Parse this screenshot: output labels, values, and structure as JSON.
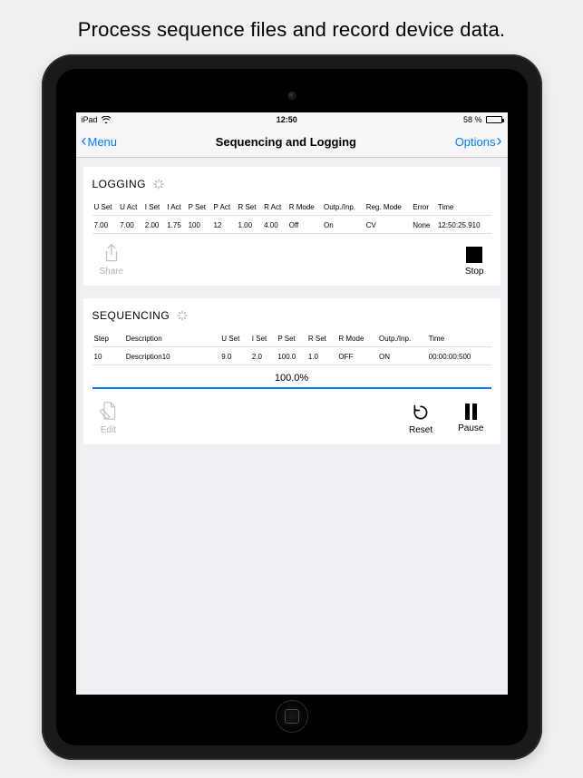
{
  "promo": "Process sequence files and record device data.",
  "statusbar": {
    "carrier": "iPad",
    "time": "12:50",
    "battery_text": "58 %"
  },
  "nav": {
    "back": "Menu",
    "title": "Sequencing and Logging",
    "right": "Options"
  },
  "logging": {
    "title": "LOGGING",
    "headers": [
      "U Set",
      "U Act",
      "I Set",
      "I Act",
      "P Set",
      "P Act",
      "R Set",
      "R Act",
      "R Mode",
      "Outp./Inp.",
      "Reg. Mode",
      "Error",
      "Time"
    ],
    "row": [
      "7.00",
      "7.00",
      "2.00",
      "1.75",
      "100",
      "12",
      "1.00",
      "4.00",
      "Off",
      "On",
      "CV",
      "None",
      "12:50:25.910"
    ],
    "share_label": "Share",
    "stop_label": "Stop"
  },
  "sequencing": {
    "title": "SEQUENCING",
    "headers": [
      "Step",
      "Description",
      "U Set",
      "I Set",
      "P Set",
      "R Set",
      "R Mode",
      "Outp./Inp.",
      "Time"
    ],
    "row": [
      "10",
      "Description10",
      "9.0",
      "2.0",
      "100.0",
      "1.0",
      "OFF",
      "ON",
      "00:00:00:500"
    ],
    "progress_text": "100.0%",
    "edit_label": "Edit",
    "reset_label": "Reset",
    "pause_label": "Pause"
  }
}
